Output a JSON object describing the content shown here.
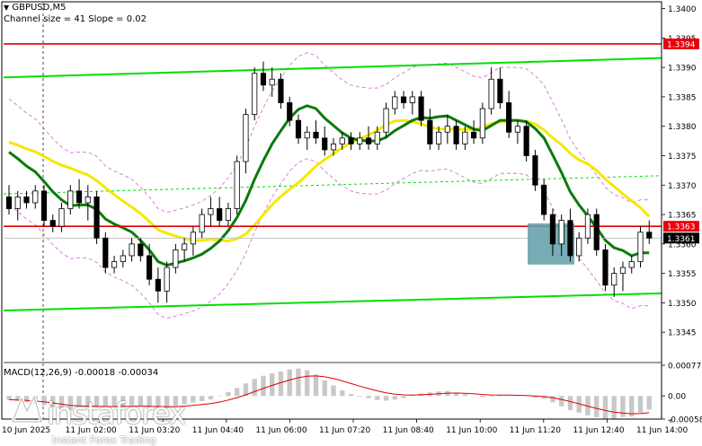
{
  "header": {
    "symbol": "GBPUSD,M5",
    "channel_info": "Channel size = 41 Slope = 0.02",
    "macd_info": "MACD(12,26,9) -0.00018 -0.00034"
  },
  "price_axis": {
    "ticks": [
      "1.3400",
      "1.3395",
      "1.3390",
      "1.3385",
      "1.3380",
      "1.3375",
      "1.3370",
      "1.3365",
      "1.3360",
      "1.3355",
      "1.3350",
      "1.3345"
    ],
    "tick_values": [
      1.34,
      1.3395,
      1.339,
      1.3385,
      1.338,
      1.3375,
      1.337,
      1.3365,
      1.336,
      1.3355,
      1.335,
      1.3345
    ],
    "labels": [
      {
        "text": "1.3394",
        "value": 1.3394,
        "bg": "#e8000b"
      },
      {
        "text": "1.3363",
        "value": 1.3363,
        "bg": "#e8000b"
      },
      {
        "text": "1.3361",
        "value": 1.3361,
        "bg": "#000000"
      }
    ]
  },
  "macd_axis": {
    "ticks": [
      "0.00077",
      "0.00",
      "-0.00058"
    ],
    "tick_values": [
      0.00077,
      0.0,
      -0.00058
    ]
  },
  "time_axis": {
    "labels": [
      "10 Jun 2025",
      "11 Jun 02:00",
      "11 Jun 03:20",
      "11 Jun 04:40",
      "11 Jun 06:00",
      "11 Jun 07:20",
      "11 Jun 08:40",
      "11 Jun 10:00",
      "11 Jun 11:20",
      "11 Jun 12:40",
      "11 Jun 14:00"
    ]
  },
  "logo": {
    "text": "instaforex",
    "sub": "Instant Forex Trading"
  },
  "colors": {
    "bull": "#000000",
    "bear": "#000000",
    "ma_fast": "#0a7a0a",
    "ma_slow": "#f5e800",
    "channel": "#00e000",
    "bands": "#cc66cc",
    "resistance": "#e00000",
    "highlight": "#5f9ea8",
    "macd_hist": "#c8c8c8",
    "macd_signal": "#e00000"
  },
  "chart_data": {
    "type": "candlestick",
    "symbol": "GBPUSD",
    "timeframe": "M5",
    "y_range": [
      1.334,
      1.3401
    ],
    "candles_ohlc": [
      [
        1.3368,
        1.337,
        1.3365,
        1.3366
      ],
      [
        1.3366,
        1.3369,
        1.3364,
        1.3368
      ],
      [
        1.3368,
        1.3369,
        1.3366,
        1.3367
      ],
      [
        1.3367,
        1.337,
        1.3366,
        1.3369
      ],
      [
        1.3369,
        1.337,
        1.3363,
        1.3364
      ],
      [
        1.3364,
        1.3365,
        1.3362,
        1.3363
      ],
      [
        1.3363,
        1.3367,
        1.3362,
        1.3366
      ],
      [
        1.3366,
        1.337,
        1.3365,
        1.3369
      ],
      [
        1.3369,
        1.3371,
        1.3366,
        1.3367
      ],
      [
        1.3367,
        1.337,
        1.3364,
        1.3368
      ],
      [
        1.3368,
        1.3369,
        1.336,
        1.3361
      ],
      [
        1.3361,
        1.3362,
        1.3355,
        1.3356
      ],
      [
        1.3356,
        1.3358,
        1.3355,
        1.3357
      ],
      [
        1.3357,
        1.3359,
        1.3356,
        1.3358
      ],
      [
        1.3358,
        1.3361,
        1.3357,
        1.336
      ],
      [
        1.336,
        1.3361,
        1.3357,
        1.3358
      ],
      [
        1.3358,
        1.336,
        1.3353,
        1.3354
      ],
      [
        1.3354,
        1.3356,
        1.335,
        1.3352
      ],
      [
        1.3352,
        1.3357,
        1.335,
        1.3356
      ],
      [
        1.3356,
        1.336,
        1.3355,
        1.3359
      ],
      [
        1.3359,
        1.3361,
        1.3357,
        1.336
      ],
      [
        1.336,
        1.3363,
        1.3358,
        1.3362
      ],
      [
        1.3362,
        1.3366,
        1.3361,
        1.3365
      ],
      [
        1.3365,
        1.3368,
        1.3363,
        1.3366
      ],
      [
        1.3366,
        1.3368,
        1.3363,
        1.3364
      ],
      [
        1.3364,
        1.3367,
        1.3363,
        1.3366
      ],
      [
        1.3366,
        1.3375,
        1.3365,
        1.3374
      ],
      [
        1.3374,
        1.3383,
        1.3372,
        1.3382
      ],
      [
        1.3382,
        1.339,
        1.3381,
        1.3389
      ],
      [
        1.3389,
        1.3391,
        1.3386,
        1.3387
      ],
      [
        1.3387,
        1.339,
        1.3385,
        1.3388
      ],
      [
        1.3388,
        1.3389,
        1.3383,
        1.3384
      ],
      [
        1.3384,
        1.3385,
        1.338,
        1.3381
      ],
      [
        1.3381,
        1.3382,
        1.3377,
        1.3378
      ],
      [
        1.3378,
        1.338,
        1.3376,
        1.3379
      ],
      [
        1.3379,
        1.3381,
        1.3377,
        1.3378
      ],
      [
        1.3378,
        1.338,
        1.3375,
        1.3376
      ],
      [
        1.3376,
        1.3378,
        1.3375,
        1.3377
      ],
      [
        1.3377,
        1.3379,
        1.3376,
        1.3378
      ],
      [
        1.3378,
        1.3379,
        1.3376,
        1.3377
      ],
      [
        1.3377,
        1.3379,
        1.3376,
        1.3378
      ],
      [
        1.3378,
        1.338,
        1.3376,
        1.3377
      ],
      [
        1.3377,
        1.338,
        1.3376,
        1.3379
      ],
      [
        1.3379,
        1.3384,
        1.3378,
        1.3383
      ],
      [
        1.3383,
        1.3386,
        1.3382,
        1.3385
      ],
      [
        1.3385,
        1.3386,
        1.3383,
        1.3384
      ],
      [
        1.3384,
        1.3386,
        1.3382,
        1.3385
      ],
      [
        1.3385,
        1.3386,
        1.338,
        1.3381
      ],
      [
        1.3381,
        1.3383,
        1.3376,
        1.3377
      ],
      [
        1.3377,
        1.338,
        1.3376,
        1.3379
      ],
      [
        1.3379,
        1.3382,
        1.3377,
        1.338
      ],
      [
        1.338,
        1.3381,
        1.3376,
        1.3377
      ],
      [
        1.3377,
        1.338,
        1.3376,
        1.3379
      ],
      [
        1.3379,
        1.3381,
        1.3377,
        1.3378
      ],
      [
        1.3378,
        1.3384,
        1.3377,
        1.3383
      ],
      [
        1.3383,
        1.339,
        1.3382,
        1.3388
      ],
      [
        1.3388,
        1.339,
        1.3383,
        1.3384
      ],
      [
        1.3384,
        1.3386,
        1.3378,
        1.3379
      ],
      [
        1.3379,
        1.3381,
        1.3377,
        1.338
      ],
      [
        1.338,
        1.3381,
        1.3374,
        1.3375
      ],
      [
        1.3375,
        1.3376,
        1.3369,
        1.337
      ],
      [
        1.337,
        1.3371,
        1.3364,
        1.3365
      ],
      [
        1.3365,
        1.3366,
        1.3358,
        1.336
      ],
      [
        1.336,
        1.3365,
        1.3358,
        1.3364
      ],
      [
        1.3364,
        1.3366,
        1.3357,
        1.3358
      ],
      [
        1.3358,
        1.3362,
        1.3357,
        1.3361
      ],
      [
        1.3361,
        1.3366,
        1.336,
        1.3365
      ],
      [
        1.3365,
        1.3366,
        1.3358,
        1.3359
      ],
      [
        1.3359,
        1.336,
        1.3352,
        1.3353
      ],
      [
        1.3353,
        1.3356,
        1.3351,
        1.3355
      ],
      [
        1.3355,
        1.3357,
        1.3352,
        1.3356
      ],
      [
        1.3356,
        1.3358,
        1.3355,
        1.3357
      ],
      [
        1.3357,
        1.3363,
        1.3356,
        1.3362
      ],
      [
        1.3362,
        1.3364,
        1.336,
        1.3361
      ]
    ],
    "horizontal_levels": [
      {
        "label": "1.3394",
        "value": 1.3394,
        "role": "resistance"
      },
      {
        "label": "1.3363",
        "value": 1.3363,
        "role": "resistance"
      },
      {
        "label": "1.3361",
        "value": 1.3361,
        "role": "current"
      }
    ],
    "macd": {
      "params": "12,26,9",
      "main": -0.00018,
      "signal": -0.00034,
      "ylim": [
        -0.00058,
        0.00077
      ]
    }
  }
}
